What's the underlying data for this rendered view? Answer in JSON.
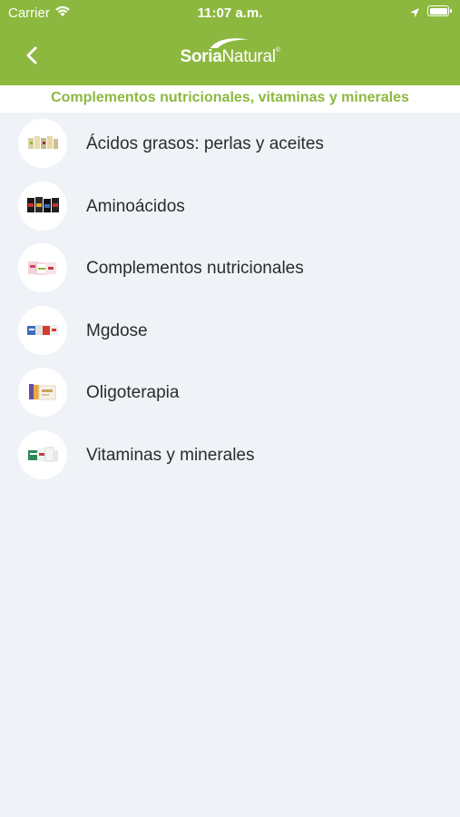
{
  "status_bar": {
    "carrier": "Carrier",
    "time": "11:07 a.m."
  },
  "header": {
    "brand_bold": "Soria",
    "brand_light": "Natural",
    "brand_mark": "®",
    "background_color": "#8cb83f"
  },
  "page": {
    "title": "Complementos nutricionales, vitaminas y minerales"
  },
  "categories": [
    {
      "label": "Ácidos grasos: perlas y aceites",
      "icon": "product-bottles-thumbnail"
    },
    {
      "label": "Aminoácidos",
      "icon": "product-jars-thumbnail"
    },
    {
      "label": "Complementos nutricionales",
      "icon": "product-boxes-thumbnail"
    },
    {
      "label": "Mgdose",
      "icon": "product-sachets-thumbnail"
    },
    {
      "label": "Oligoterapia",
      "icon": "product-vials-thumbnail"
    },
    {
      "label": "Vitaminas y minerales",
      "icon": "product-tubes-thumbnail"
    }
  ]
}
